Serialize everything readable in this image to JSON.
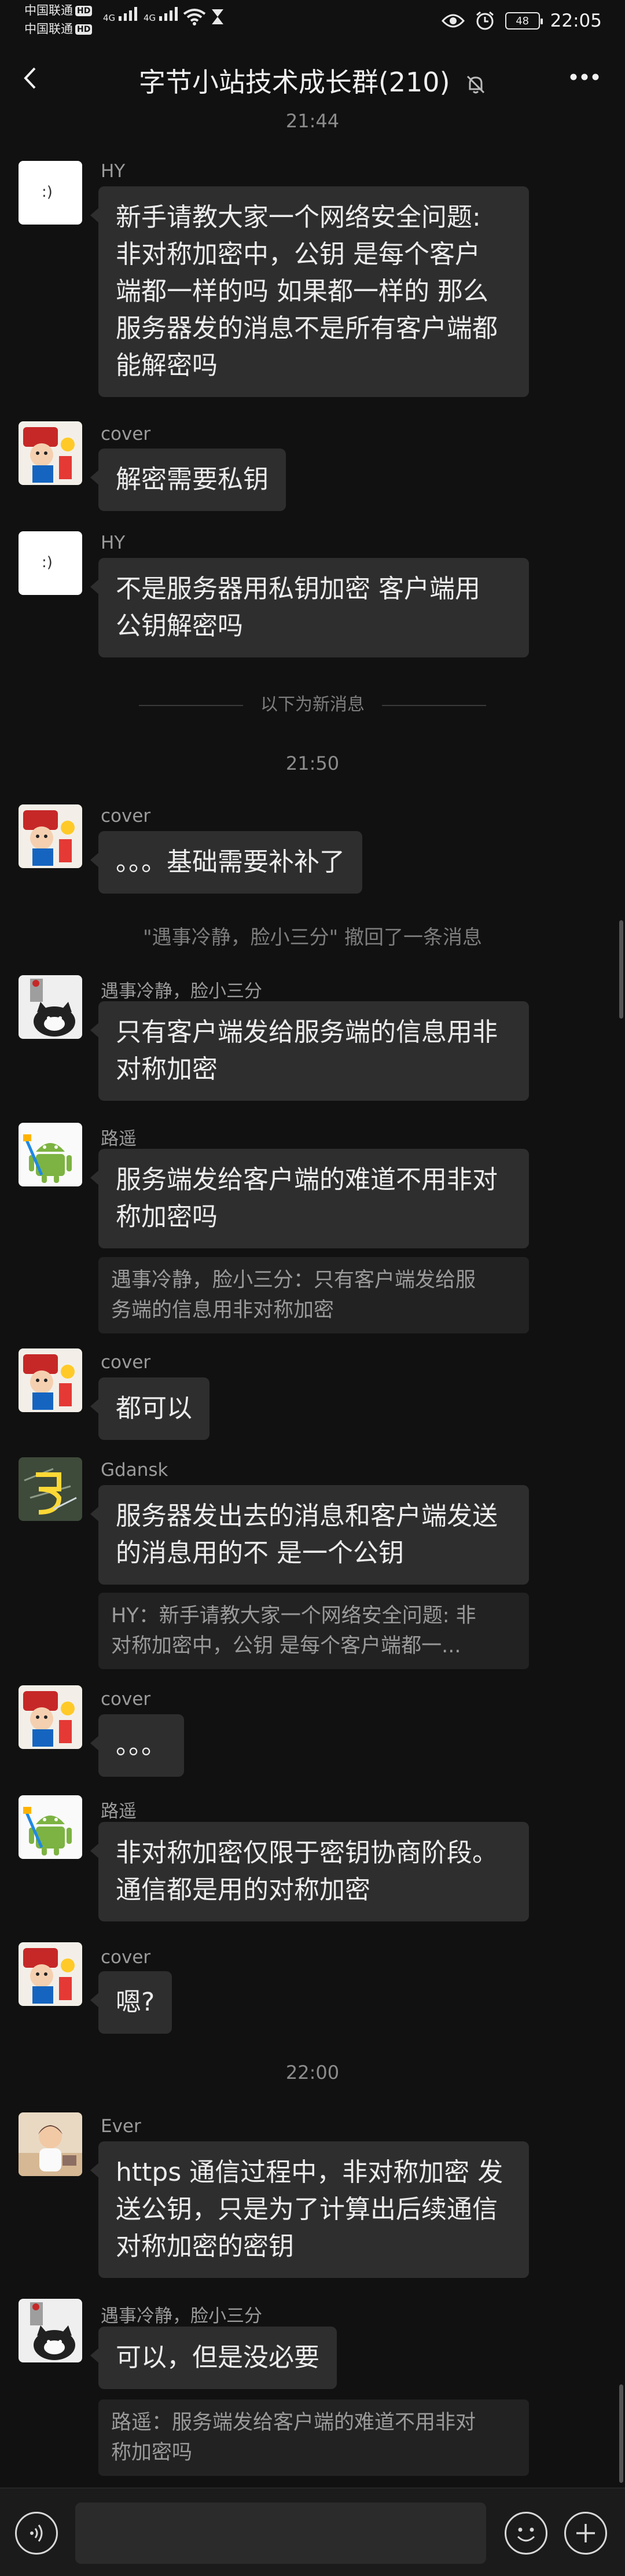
{
  "status_bar": {
    "carrier_1": "中国联通",
    "carrier_2": "中国联通",
    "hd_badge": "HD",
    "network_1": "4G",
    "network_2": "4G",
    "battery": "48",
    "time": "22:05"
  },
  "header": {
    "title": "字节小站技术成长群(210)"
  },
  "chat": {
    "top_time": "21:44",
    "new_messages_divider": "以下为新消息",
    "time_1": "21:50",
    "time_2": "22:00",
    "recall_notice": "\"遇事冷静，脸小三分\" 撤回了一条消息",
    "messages": [
      {
        "sender": "HY",
        "lines": [
          "新手请教大家一个网络安全问题:",
          "非对称加密中，公钥  是每个客户",
          "端都一样的吗  如果都一样的  那么",
          "服务器发的消息不是所有客户端都",
          "能解密吗"
        ]
      },
      {
        "sender": "cover",
        "lines": [
          "解密需要私钥"
        ]
      },
      {
        "sender": "HY",
        "lines": [
          "不是服务器用私钥加密  客户端用",
          "公钥解密吗"
        ]
      },
      {
        "sender": "cover",
        "lines": [
          "。。。基础需要补补了"
        ]
      },
      {
        "sender": "遇事冷静，脸小三分",
        "lines": [
          "只有客户端发给服务端的信息用非",
          "对称加密"
        ]
      },
      {
        "sender": "路遥",
        "lines": [
          "服务端发给客户端的难道不用非对",
          "称加密吗"
        ],
        "quote": [
          "遇事冷静，脸小三分：只有客户端发给服",
          "务端的信息用非对称加密"
        ]
      },
      {
        "sender": "cover",
        "lines": [
          "都可以"
        ]
      },
      {
        "sender": "Gdansk",
        "lines": [
          "服务器发出去的消息和客户端发送",
          "的消息用的不 是一个公钥"
        ],
        "quote": [
          "HY：新手请教大家一个网络安全问题: 非",
          "对称加密中，公钥  是每个客户端都一..."
        ]
      },
      {
        "sender": "cover",
        "lines": [
          "。。。"
        ]
      },
      {
        "sender": "路遥",
        "lines": [
          "非对称加密仅限于密钥协商阶段。",
          "通信都是用的对称加密"
        ]
      },
      {
        "sender": "cover",
        "lines": [
          "嗯?"
        ]
      },
      {
        "sender": "Ever",
        "lines": [
          "https 通信过程中，非对称加密 发",
          "送公钥，只是为了计算出后续通信",
          "对称加密的密钥"
        ]
      },
      {
        "sender": "遇事冷静，脸小三分",
        "lines": [
          "可以，但是没必要"
        ],
        "quote": [
          "路遥：服务端发给客户端的难道不用非对",
          "称加密吗"
        ]
      }
    ]
  },
  "input_bar": {
    "placeholder": ""
  },
  "colors": {
    "background": "#111111",
    "bubble": "#2e2e2e",
    "quote": "#222222"
  },
  "icons": {
    "back": "back-arrow-icon",
    "mute": "mute-bell-icon",
    "more": "more-icon",
    "voice": "voice-icon",
    "emoji": "emoji-icon",
    "plus": "plus-icon"
  }
}
